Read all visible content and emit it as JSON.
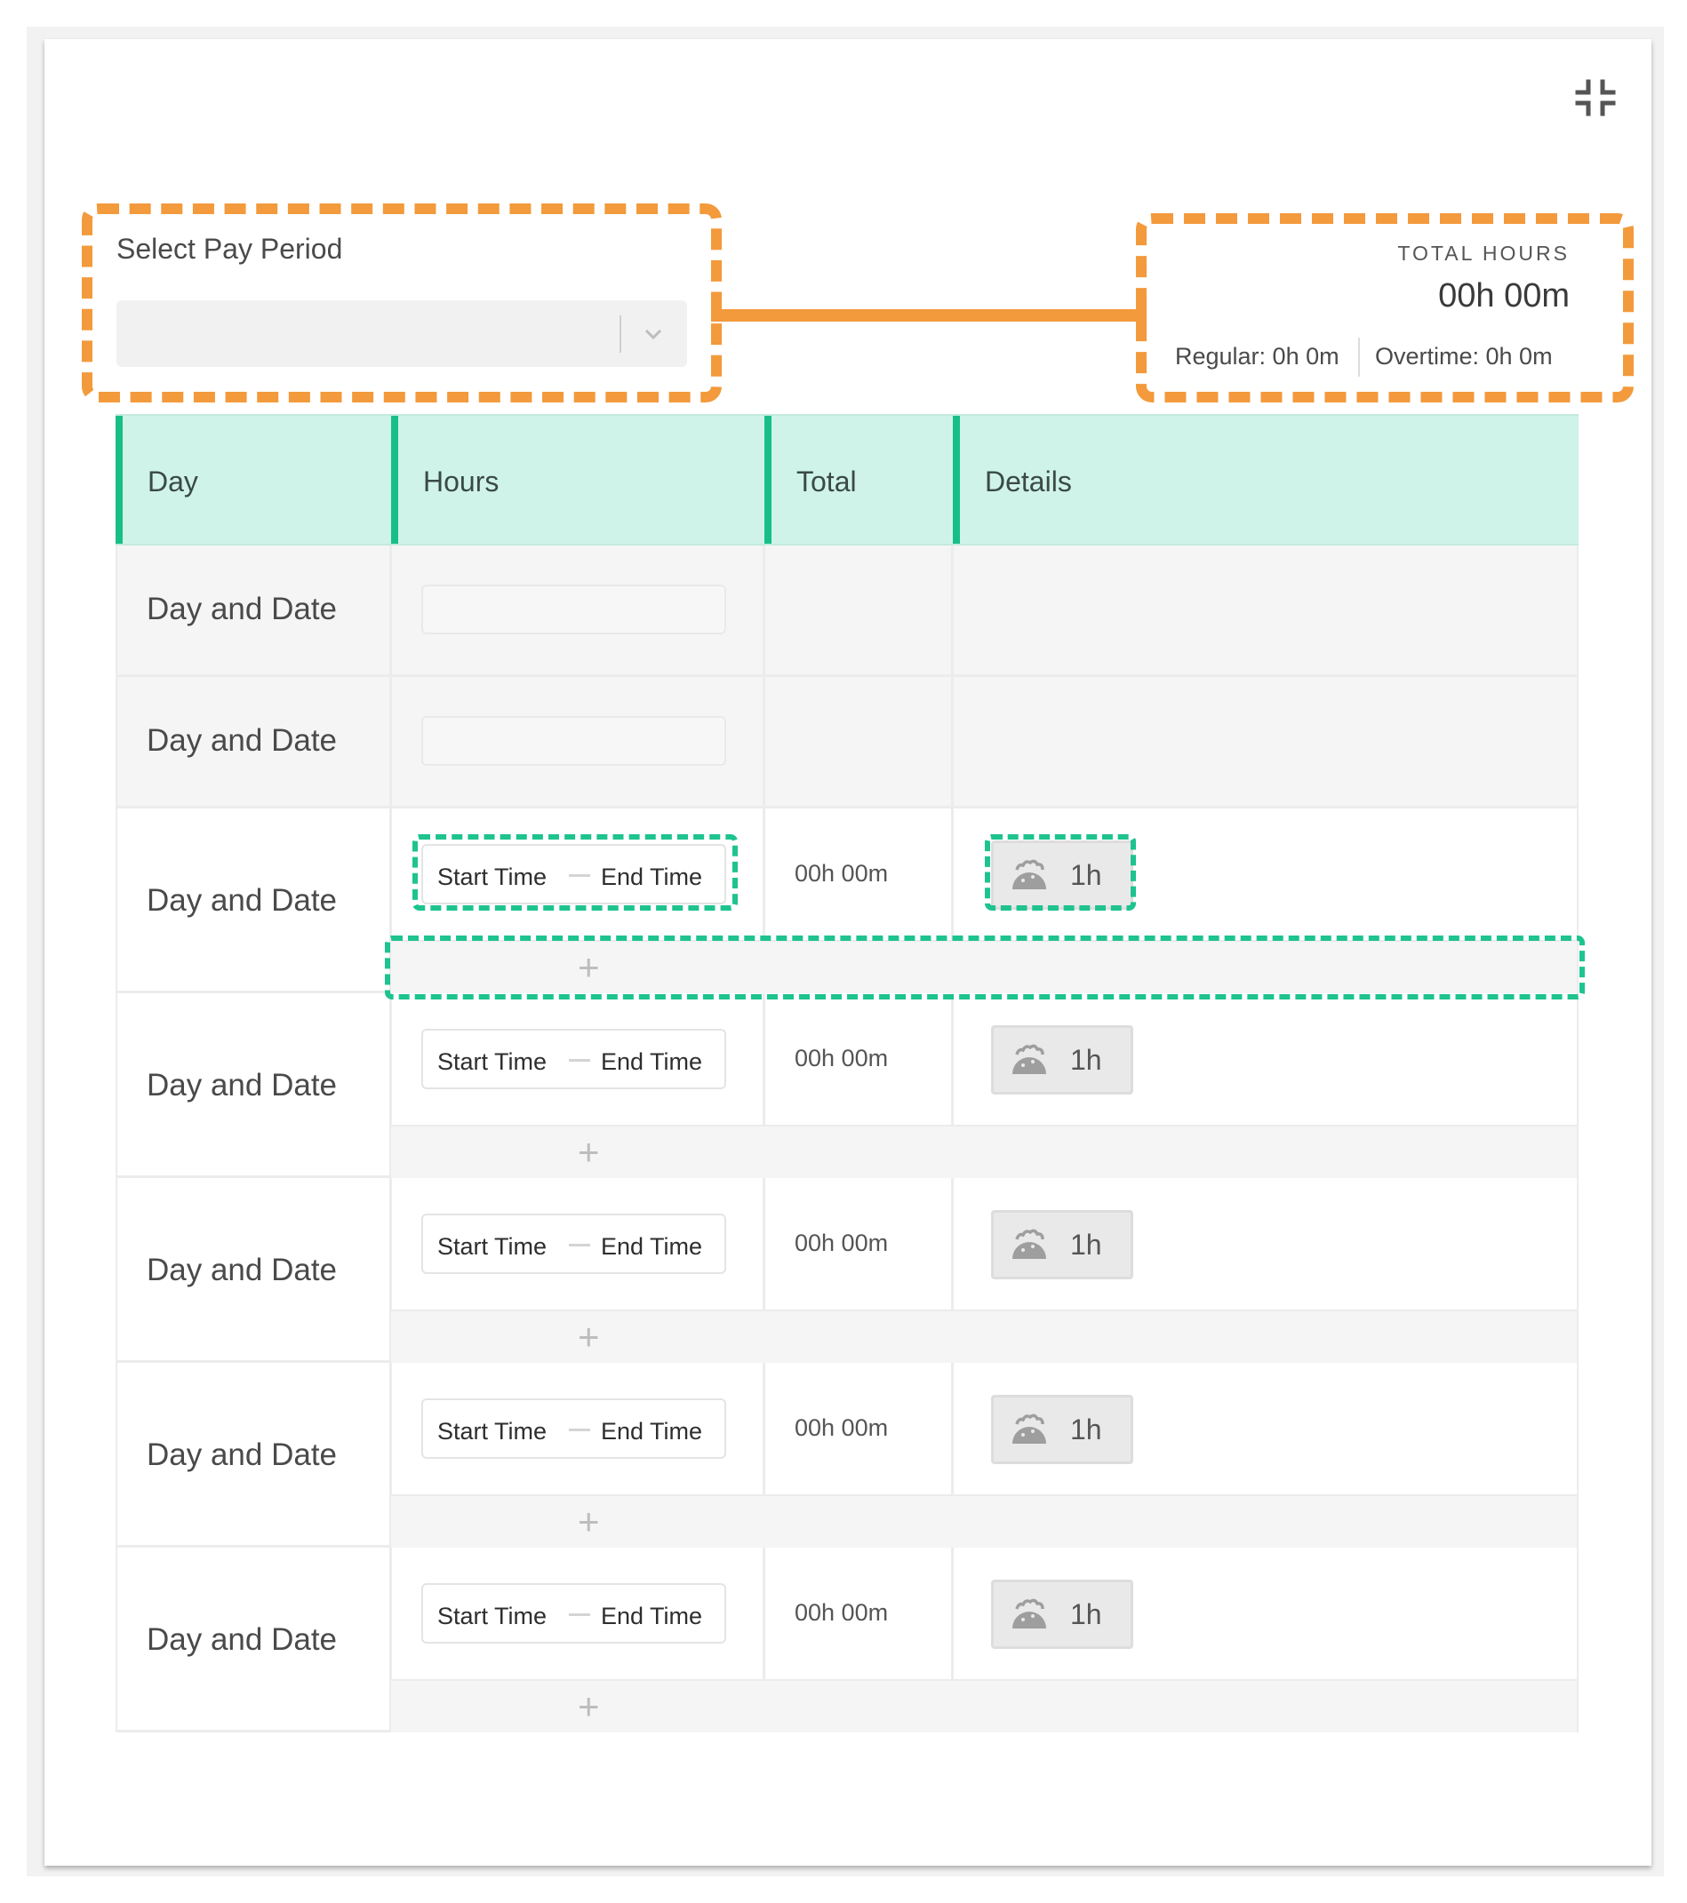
{
  "pay_period": {
    "label": "Select Pay Period",
    "selected_value": ""
  },
  "total_hours": {
    "label": "TOTAL HOURS",
    "value": "00h 00m",
    "regular": "Regular: 0h 0m",
    "overtime": "Overtime: 0h 0m"
  },
  "table": {
    "headers": [
      "Day",
      "Hours",
      "Total",
      "Details"
    ],
    "empty_rows": [
      {
        "day": "Day and Date"
      },
      {
        "day": "Day and Date"
      }
    ],
    "entry_rows": [
      {
        "day": "Day and Date",
        "start": "Start Time",
        "end": "End Time",
        "total": "00h 00m",
        "break": "1h",
        "add": "+"
      },
      {
        "day": "Day and Date",
        "start": "Start Time",
        "end": "End Time",
        "total": "00h 00m",
        "break": "1h",
        "add": "+"
      },
      {
        "day": "Day and Date",
        "start": "Start Time",
        "end": "End Time",
        "total": "00h 00m",
        "break": "1h",
        "add": "+"
      },
      {
        "day": "Day and Date",
        "start": "Start Time",
        "end": "End Time",
        "total": "00h 00m",
        "break": "1h",
        "add": "+"
      },
      {
        "day": "Day and Date",
        "start": "Start Time",
        "end": "End Time",
        "total": "00h 00m",
        "break": "1h",
        "add": "+"
      }
    ]
  },
  "icons": {
    "collapse": "collapse-icon",
    "chevron": "chevron-down-icon",
    "break": "taco-icon"
  },
  "colors": {
    "accent": "#17bf86",
    "header_bg": "#d0f3e9",
    "annotation_orange": "#f39a3c",
    "annotation_green": "#1ec38f"
  }
}
